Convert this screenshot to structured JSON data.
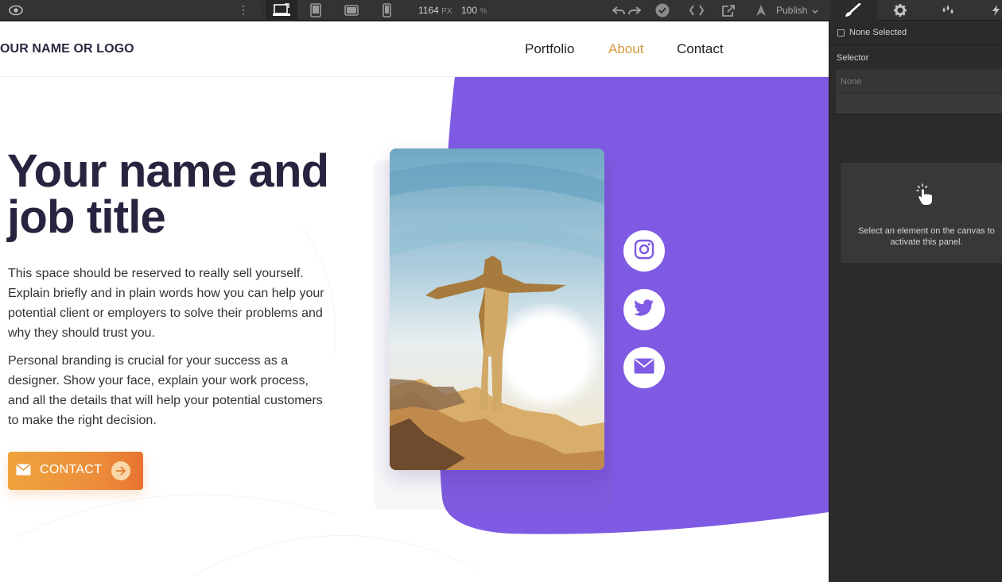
{
  "toolbar": {
    "width_value": "1164",
    "width_unit": "PX",
    "zoom_value": "100",
    "zoom_unit": "%",
    "publish_label": "Publish",
    "icons": [
      "eye-icon",
      "drag-handle-icon",
      "desktop-icon",
      "tablet-icon",
      "tablet-landscape-icon",
      "phone-icon",
      "undo-icon",
      "redo-icon",
      "check-icon",
      "code-icon",
      "export-icon",
      "publish-icon",
      "brush-icon",
      "gear-icon",
      "drops-icon",
      "bolt-icon"
    ]
  },
  "site": {
    "logo": "OUR NAME OR LOGO",
    "nav": [
      {
        "label": "Portfolio"
      },
      {
        "label": "About"
      },
      {
        "label": "Contact"
      }
    ],
    "nav_active_color": "#d49a3e",
    "hero": {
      "title_line1": "Your name and",
      "title_line2": "job title",
      "paragraph1": "This space should be reserved to really sell yourself. Explain briefly and in plain words how you can help your potential client or employers to solve their problems and why they should trust you.",
      "paragraph2": "Personal branding is crucial for your success as a designer. Show your face, explain your work process, and all the details that will help your potential customers to make the right decision.",
      "cta_label": "CONTACT"
    },
    "social": [
      "instagram-icon",
      "twitter-icon",
      "email-icon"
    ],
    "accent_purple": "#7f5ae3",
    "accent_orange": "#ec8b3b"
  },
  "panel": {
    "none_selected": "None Selected",
    "selector_label": "Selector",
    "selector_placeholder": "None",
    "hint": "Select an element on the canvas to activate this panel."
  }
}
